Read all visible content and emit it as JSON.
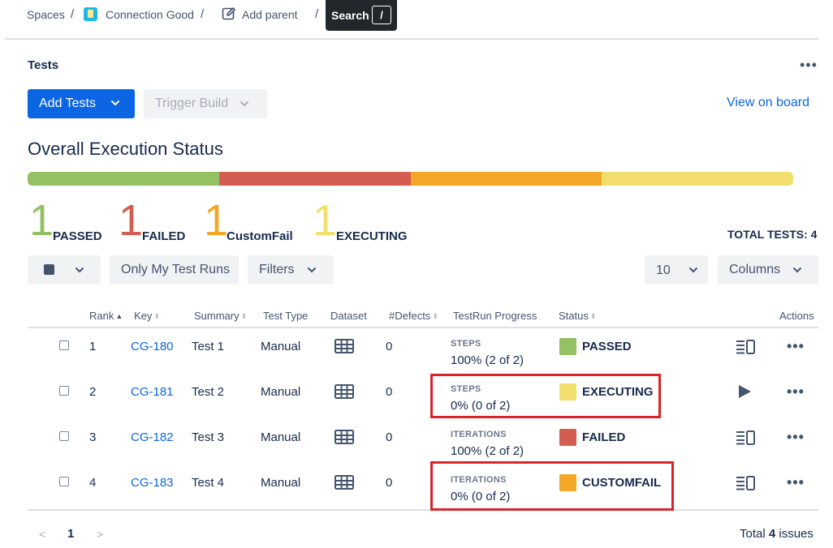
{
  "breadcrumb": {
    "spaces": "Spaces",
    "sep": "/",
    "space_name": "Connection Good",
    "add_parent": "Add parent",
    "search_label": "Search",
    "search_key": "/"
  },
  "panel": {
    "title": "Tests",
    "more": "•••",
    "add_tests": "Add Tests",
    "trigger_build": "Trigger Build",
    "view_on_board": "View on board"
  },
  "execution": {
    "title": "Overall Execution Status",
    "colors": {
      "passed": "#94c162",
      "failed": "#d45d52",
      "customfail": "#f4a627",
      "executing": "#f2de6c"
    },
    "progress_fractions": {
      "passed": 0.25,
      "failed": 0.25,
      "customfail": 0.25,
      "executing": 0.25
    },
    "stats": [
      {
        "count": "1",
        "label": "PASSED"
      },
      {
        "count": "1",
        "label": "FAILED"
      },
      {
        "count": "1",
        "label": "CustomFail"
      },
      {
        "count": "1",
        "label": "EXECUTING"
      }
    ],
    "total_tests": "TOTAL TESTS: 4"
  },
  "toolbar": {
    "only_my": "Only My Test Runs",
    "filters": "Filters",
    "page_size": "10",
    "columns": "Columns"
  },
  "table": {
    "headers": {
      "rank": "Rank",
      "key": "Key",
      "summary": "Summary",
      "test_type": "Test Type",
      "dataset": "Dataset",
      "defects": "#Defects",
      "progress": "TestRun Progress",
      "status": "Status",
      "actions": "Actions"
    },
    "rows": [
      {
        "rank": "1",
        "key": "CG-180",
        "summary": "Test 1",
        "type": "Manual",
        "defects": "0",
        "progress_caption": "STEPS",
        "progress_value": "100% (2 of 2)",
        "status": "PASSED",
        "status_color": "#94c162",
        "action_icon": "details-icon"
      },
      {
        "rank": "2",
        "key": "CG-181",
        "summary": "Test 2",
        "type": "Manual",
        "defects": "0",
        "progress_caption": "STEPS",
        "progress_value": "0% (0 of 2)",
        "status": "EXECUTING",
        "status_color": "#f2de6c",
        "action_icon": "play-icon"
      },
      {
        "rank": "3",
        "key": "CG-182",
        "summary": "Test 3",
        "type": "Manual",
        "defects": "0",
        "progress_caption": "ITERATIONS",
        "progress_value": "100% (2 of 2)",
        "status": "FAILED",
        "status_color": "#d45d52",
        "action_icon": "details-icon"
      },
      {
        "rank": "4",
        "key": "CG-183",
        "summary": "Test 4",
        "type": "Manual",
        "defects": "0",
        "progress_caption": "ITERATIONS",
        "progress_value": "0% (0 of 2)",
        "status": "CUSTOMFAIL",
        "status_color": "#f4a627",
        "action_icon": "details-icon"
      }
    ]
  },
  "pagination": {
    "prev": "<",
    "current": "1",
    "next": ">",
    "total_prefix": "Total",
    "total_count": "4",
    "total_suffix": "issues"
  }
}
